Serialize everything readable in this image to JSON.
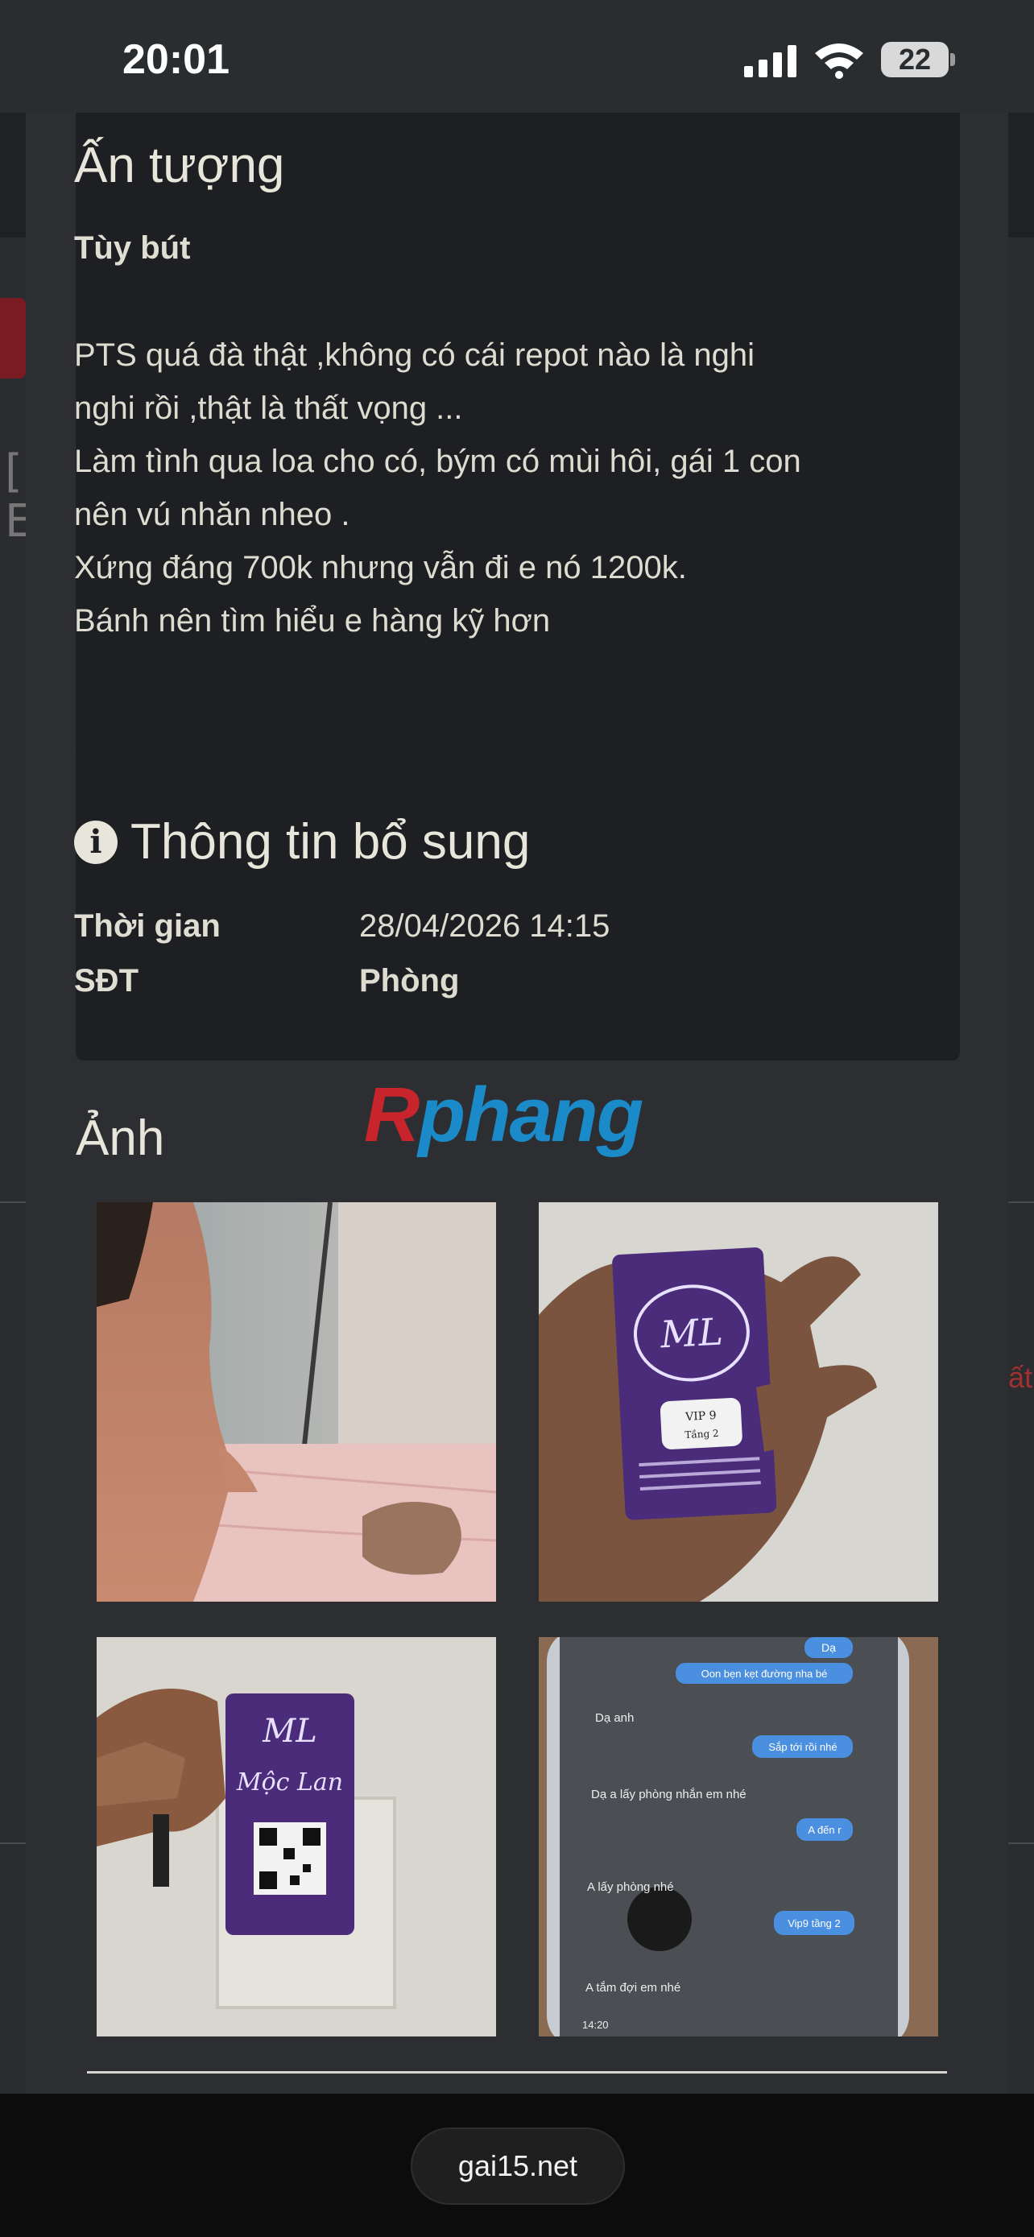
{
  "status_bar": {
    "time": "20:01",
    "battery_level": "22"
  },
  "impression_card": {
    "heading": "Ấn tượng",
    "subtitle": "Tùy bút",
    "lines": [
      "PTS quá đà thật ,không có cái repot nào là nghi",
      "nghi rồi ,thật là thất vọng ...",
      "Làm tình qua loa cho có, bým có mùi hôi, gái 1 con",
      "nên vú nhăn nheo .",
      "Xứng đáng 700k nhưng vẫn đi e nó 1200k.",
      "Bánh nên tìm hiểu e hàng kỹ hơn"
    ]
  },
  "info_card": {
    "title": "Thông tin bổ sung",
    "rows": [
      {
        "label": "Thời gian",
        "value": "28/04/2026 14:15"
      },
      {
        "label": "SĐT",
        "value": "Phòng"
      }
    ]
  },
  "photos": {
    "heading": "Ảnh",
    "watermark_first": "R",
    "watermark_rest": "phang",
    "card_texts": {
      "vip": "VIP 9",
      "floor": "Tầng 2",
      "brand": "Mộc Lan"
    },
    "chat_messages": [
      "Dạ",
      "Oon bẹn kẹt đường nha bé",
      "Dạ anh",
      "Sắp tới rồi nhé",
      "Dạ a lấy phòng nhắn em nhé",
      "A đến r",
      "A lấy phòng nhé",
      "Vip9 tầng 2",
      "A tắm đợi em nhé"
    ],
    "chat_time": "14:20"
  },
  "browser": {
    "url": "gai15.net"
  },
  "background": {
    "glyph_top": "[",
    "glyph_bottom": "E",
    "red_fragment": "ất"
  }
}
